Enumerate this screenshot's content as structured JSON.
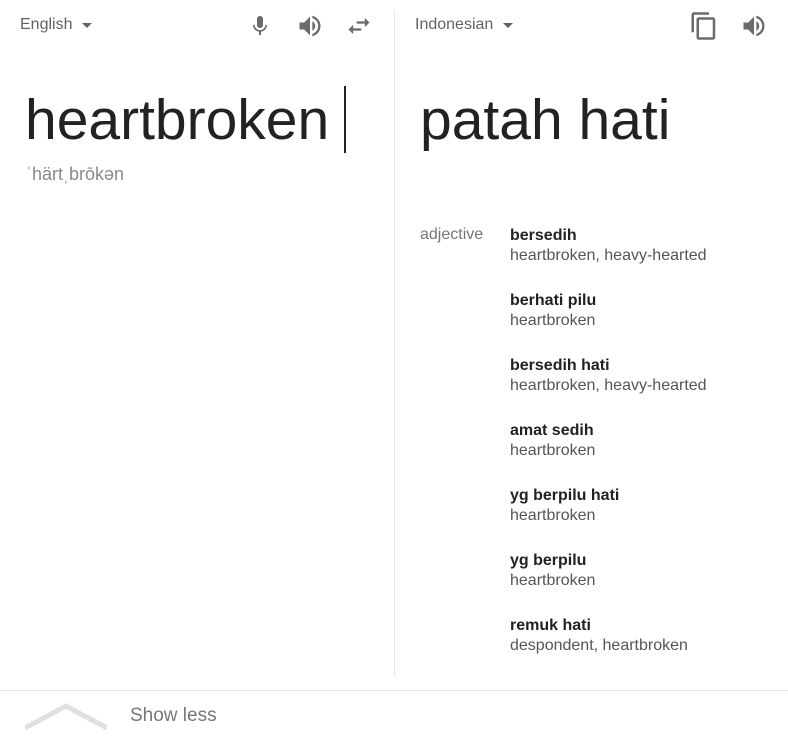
{
  "source": {
    "language": "English",
    "text": "heartbroken",
    "phonetic": "ˈhärtˌbrōkən",
    "icons": [
      "microphone-icon",
      "speaker-icon",
      "swap-icon"
    ]
  },
  "target": {
    "language": "Indonesian",
    "text": "patah hati",
    "icons": [
      "copy-icon",
      "speaker-icon"
    ]
  },
  "dictionary": {
    "part_of_speech": "adjective",
    "entries": [
      {
        "word": "bersedih",
        "synonyms": "heartbroken, heavy-hearted"
      },
      {
        "word": "berhati pilu",
        "synonyms": "heartbroken"
      },
      {
        "word": "bersedih hati",
        "synonyms": "heartbroken, heavy-hearted"
      },
      {
        "word": "amat sedih",
        "synonyms": "heartbroken"
      },
      {
        "word": "yg berpilu hati",
        "synonyms": "heartbroken"
      },
      {
        "word": "yg berpilu",
        "synonyms": "heartbroken"
      },
      {
        "word": "remuk hati",
        "synonyms": "despondent, heartbroken"
      }
    ]
  },
  "footer": {
    "show_less_label": "Show less"
  },
  "colors": {
    "icon": "#6b6b6b",
    "divider": "#e6e6e6",
    "text": "#222222",
    "muted": "#757575"
  }
}
